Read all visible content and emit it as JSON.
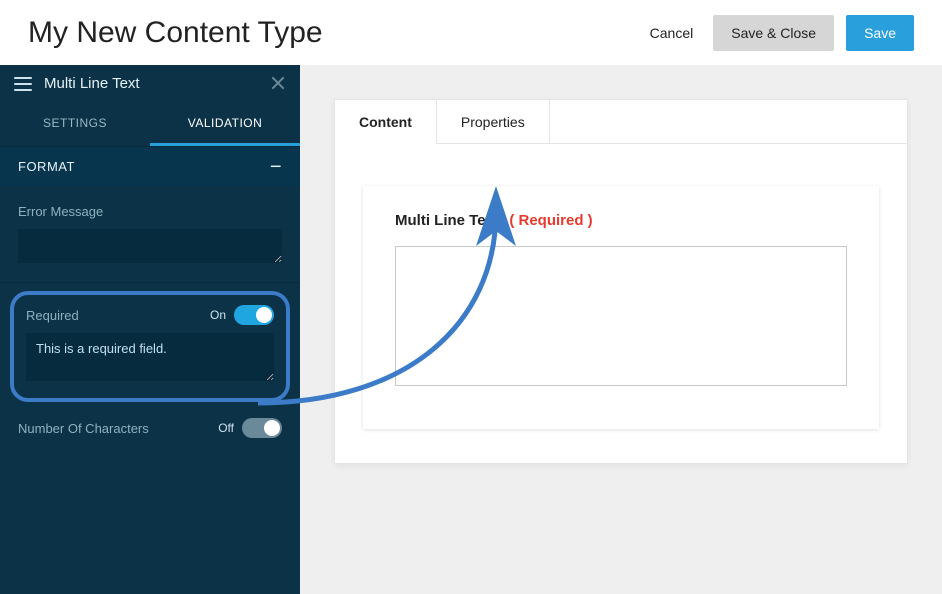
{
  "header": {
    "title": "My New Content Type",
    "cancel": "Cancel",
    "save_close": "Save & Close",
    "save": "Save"
  },
  "sidebar": {
    "panel_title": "Multi Line Text",
    "tabs": {
      "settings": "SETTINGS",
      "validation": "VALIDATION"
    },
    "format_label": "FORMAT",
    "error_message_label": "Error Message",
    "error_message_value": "",
    "required_label": "Required",
    "required_toggle_text": "On",
    "required_message": "This is a required field.",
    "numchars_label": "Number Of Characters",
    "numchars_toggle_text": "Off"
  },
  "canvas": {
    "tabs": {
      "content": "Content",
      "properties": "Properties"
    },
    "field_name": "Multi Line Text",
    "required_tag": "( Required )",
    "textarea_value": ""
  },
  "annotation": {
    "highlight_color": "#3b7bc8"
  }
}
